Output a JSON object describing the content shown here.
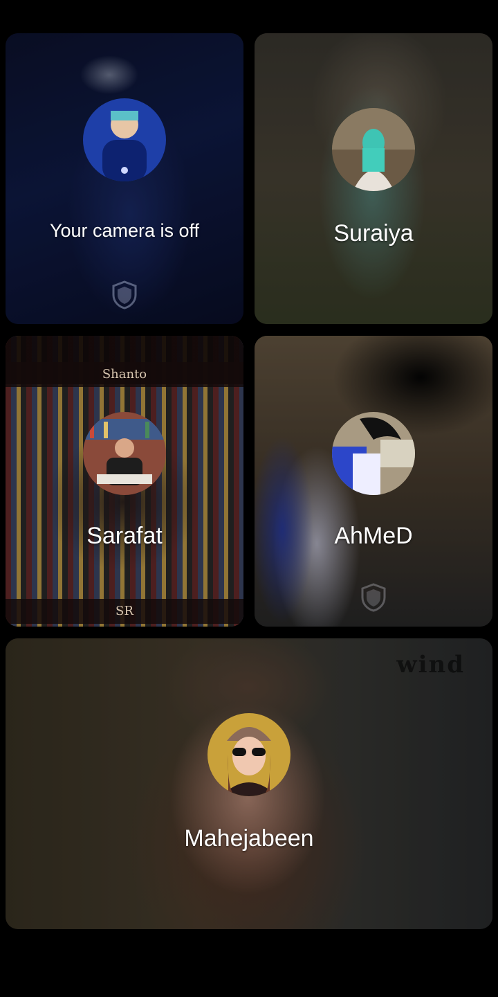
{
  "tiles": [
    {
      "label": "Your camera is off",
      "avatar": "user-avatar",
      "shield_icon": "shield-icon"
    },
    {
      "label": "Suraiya",
      "avatar": "suraiya-avatar"
    },
    {
      "label": "Sarafat",
      "avatar": "sarafat-avatar",
      "banner_top": "Shanto",
      "banner_bottom": "SR"
    },
    {
      "label": "AhMeD",
      "avatar": "ahmed-avatar",
      "shield_icon": "shield-icon"
    },
    {
      "label": "Mahejabeen",
      "avatar": "mahejabeen-avatar",
      "watermark": "wind"
    }
  ],
  "colors": {
    "background": "#000000",
    "text": "#ffffff"
  }
}
